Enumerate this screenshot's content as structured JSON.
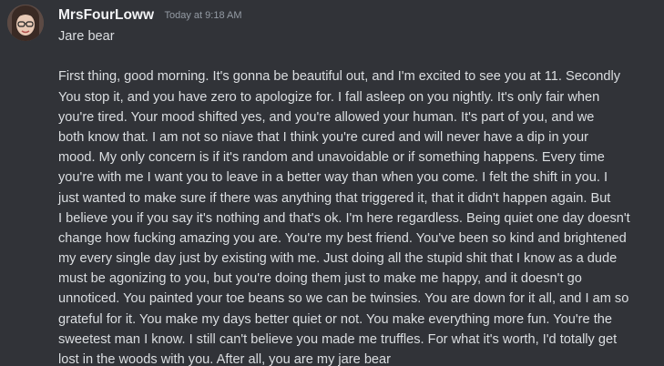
{
  "message": {
    "author": "MrsFourLoww",
    "timestamp": "Today at 9:18 AM",
    "lines": [
      "Jare bear",
      "",
      "First thing, good morning. It's gonna be beautiful out, and I'm excited to see you at 11. Secondly",
      "You stop it, and you have zero to apologize for. I fall asleep on you nightly. It's only fair when",
      "you're tired. Your mood shifted yes, and you're allowed your human. It's part of you, and we",
      "both know that. I am not so niave that I think you're cured and will never have a dip in your",
      "mood. My only concern is if it's random and unavoidable or if something happens. Every time",
      "you're with me I want you to leave in a better way than when you come. I felt the shift in you. I",
      "just wanted to make sure if there was anything that triggered it, that it didn't happen again. But",
      "I believe you if you say it's nothing and that's ok. I'm here regardless. Being quiet one day doesn't",
      "change how fucking amazing you are. You're my best friend. You've been so kind and brightened",
      "my every single day just by existing with me. Just doing all the stupid shit that I know as a dude",
      "must be agonizing to you, but you're doing them just to make me happy, and it doesn't go",
      "unnoticed. You painted your toe beans so we can be twinsies. You are down for it all, and I am so",
      "grateful for it. You make my days better quiet or not. You make everything more fun. You're the",
      "sweetest man I know. I still can't believe you made me truffles. For what it's worth, I'd totally get",
      "lost in the woods with you. After all, you are my jare bear"
    ]
  }
}
